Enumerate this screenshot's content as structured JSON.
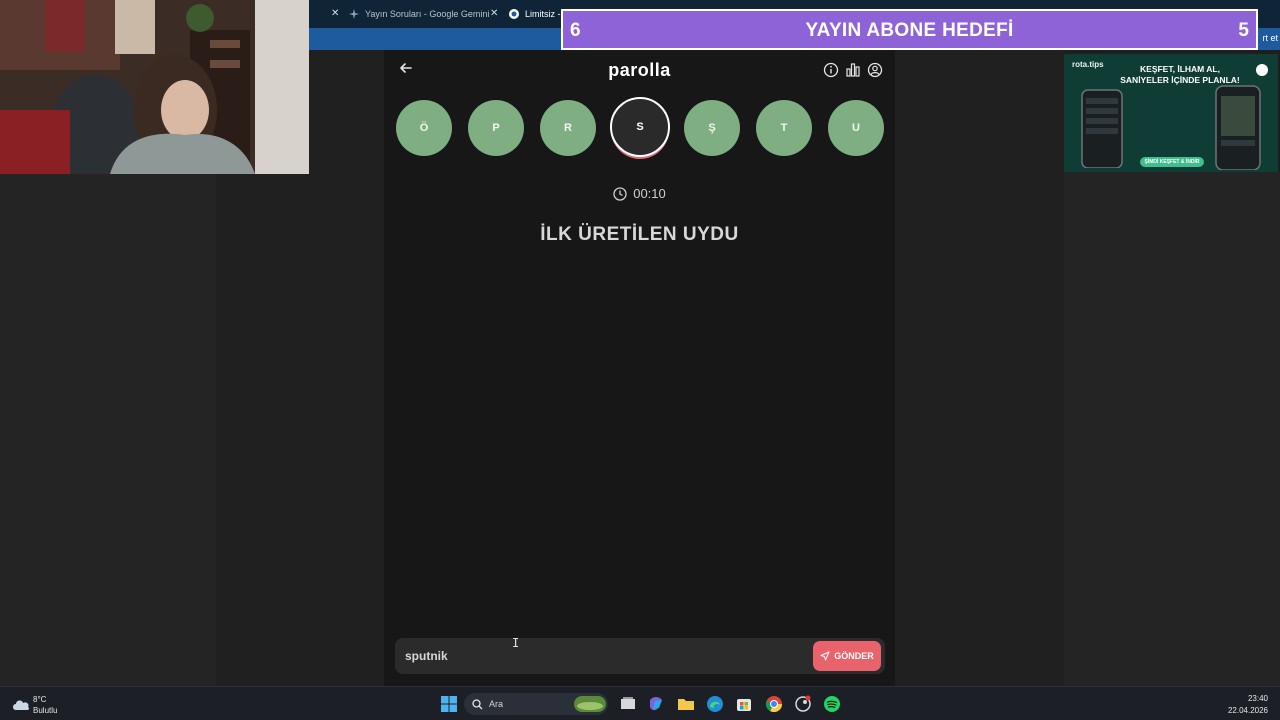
{
  "browser": {
    "tabs": [
      {
        "label": "Yayın Soruları - Google Gemini"
      },
      {
        "label": "Limitsiz -"
      }
    ],
    "address_right": "rt et"
  },
  "stream_goal": {
    "current": "6",
    "title": "YAYIN ABONE HEDEFİ",
    "target": "5"
  },
  "app": {
    "title": "parolla",
    "letters": [
      "Ö",
      "P",
      "R",
      "S",
      "Ş",
      "T",
      "U"
    ],
    "active_letter_index": 3,
    "timer": "00:10",
    "question": "İLK ÜRETİLEN UYDU",
    "answer_value": "sputnik",
    "send_label": "GÖNDER"
  },
  "ad": {
    "brand": "rota.tips",
    "headline_line1": "KEŞFET, İLHAM AL,",
    "headline_line2": "SANİYELER İÇİNDE PLANLA!",
    "cta": "ŞİMDİ KEŞFET & İNDİR"
  },
  "taskbar": {
    "weather_temp": "8°C",
    "weather_desc": "Bulutlu",
    "search_label": "Ara",
    "time": "23:40",
    "date": "22.04.2026"
  },
  "colors": {
    "letter_green": "#7fae82",
    "accent_red": "#e8636b",
    "goal_purple": "#8f63d8"
  }
}
